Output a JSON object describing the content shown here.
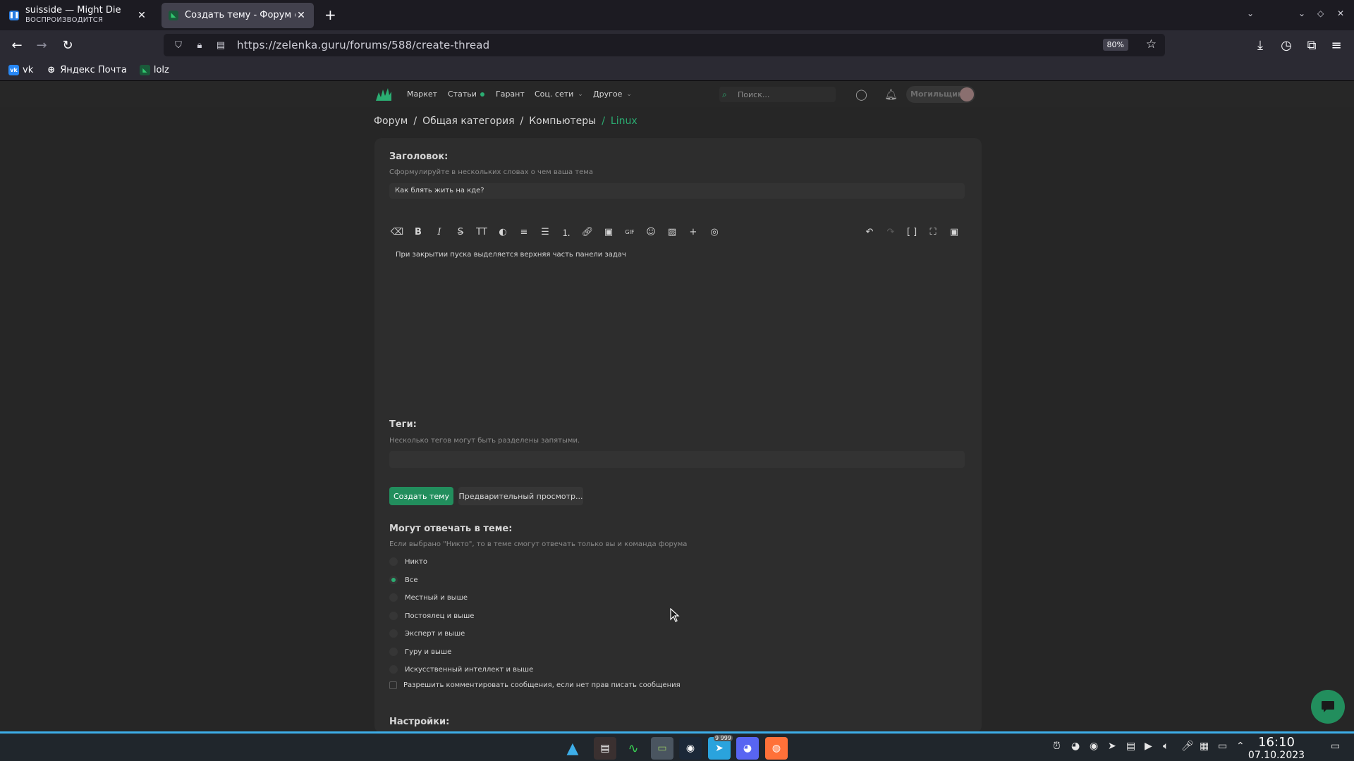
{
  "browser": {
    "tabs": [
      {
        "title": "suisside — Might Die",
        "subtitle": "ВОСПРОИЗВОДИТСЯ",
        "active": false
      },
      {
        "title": "Создать тему - Форум соц",
        "active": true
      }
    ],
    "url": "https://zelenka.guru/forums/588/create-thread",
    "zoom": "80%",
    "bookmarks": [
      "vk",
      "Яндекс Почта",
      "lolz"
    ]
  },
  "site": {
    "nav": [
      "Маркет",
      "Статьи",
      "Гарант",
      "Соц. сети",
      "Другое"
    ],
    "search_placeholder": "Поиск...",
    "username": "Могильщик"
  },
  "breadcrumb": [
    "Форум",
    "Общая категория",
    "Компьютеры",
    "Linux"
  ],
  "form": {
    "title_label": "Заголовок:",
    "title_hint": "Сформулируйте в нескольких словах о чем ваша тема",
    "title_value": "Как блять жить на кде?",
    "editor_text": "При закрытии пуска выделяется верхняя часть панели задач",
    "tags_label": "Теги:",
    "tags_hint": "Несколько тегов могут быть разделены запятыми.",
    "submit_label": "Создать тему",
    "preview_label": "Предварительный просмотр...",
    "reply_label": "Могут отвечать в теме:",
    "reply_hint": "Если выбрано \"Никто\", то в теме смогут отвечать только вы и команда форума",
    "reply_options": [
      "Никто",
      "Все",
      "Местный и выше",
      "Постоялец и выше",
      "Эксперт и выше",
      "Гуру и выше",
      "Искусственный интеллект и выше"
    ],
    "reply_selected": "Все",
    "comment_checkbox": "Разрешить комментировать сообщения, если нет прав писать сообщения",
    "settings_label": "Настройки:"
  },
  "taskbar": {
    "time": "16:10",
    "date": "07.10.2023",
    "telegram_badge": "9 999"
  },
  "colors": {
    "accent": "#2bad72",
    "button": "#228e5d",
    "page_bg": "#262626",
    "card_bg": "#2d2d2d"
  }
}
